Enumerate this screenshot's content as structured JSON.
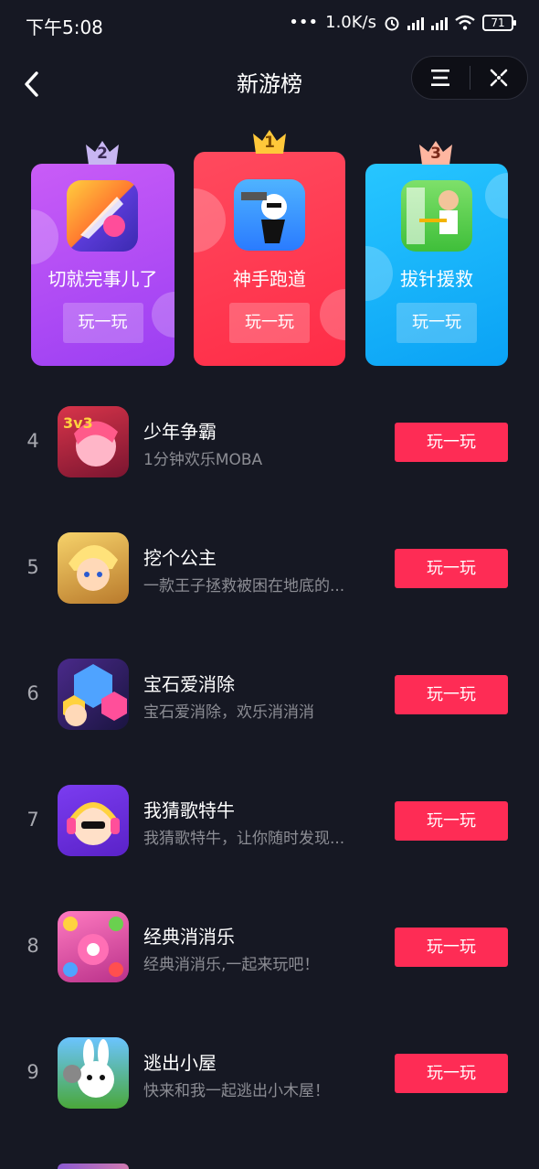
{
  "status_bar": {
    "time": "下午5:08",
    "network_speed": "1.0K/s",
    "battery": "71"
  },
  "header": {
    "title": "新游榜",
    "back_icon": "chevron-left-icon",
    "menu_icon": "menu-icon",
    "close_icon": "close-icon"
  },
  "podium": [
    {
      "rank": "2",
      "name": "切就完事儿了",
      "play_label": "玩一玩",
      "color": "#b84ff5"
    },
    {
      "rank": "1",
      "name": "神手跑道",
      "play_label": "玩一玩",
      "color": "#ff3552"
    },
    {
      "rank": "3",
      "name": "拔针援救",
      "play_label": "玩一玩",
      "color": "#19b8fb"
    }
  ],
  "games": [
    {
      "rank": "4",
      "name": "少年争霸",
      "desc": "1分钟欢乐MOBA",
      "play_label": "玩一玩"
    },
    {
      "rank": "5",
      "name": "挖个公主",
      "desc": "一款王子拯救被困在地底的...",
      "play_label": "玩一玩"
    },
    {
      "rank": "6",
      "name": "宝石爱消除",
      "desc": "宝石爱消除，欢乐消消消",
      "play_label": "玩一玩"
    },
    {
      "rank": "7",
      "name": "我猜歌特牛",
      "desc": "我猜歌特牛，让你随时发现...",
      "play_label": "玩一玩"
    },
    {
      "rank": "8",
      "name": "经典消消乐",
      "desc": "经典消消乐,一起来玩吧！",
      "play_label": "玩一玩"
    },
    {
      "rank": "9",
      "name": "逃出小屋",
      "desc": "快来和我一起逃出小木屋！",
      "play_label": "玩一玩"
    }
  ],
  "colors": {
    "background": "#161823",
    "accent": "#fe2c55"
  }
}
